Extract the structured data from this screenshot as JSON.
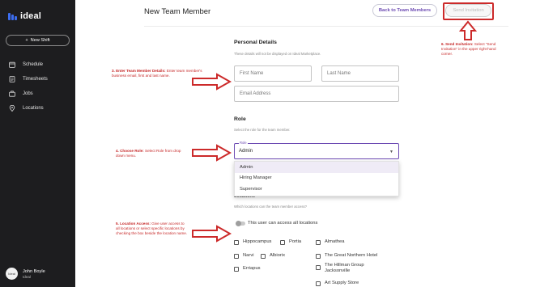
{
  "app": {
    "logo_text": "ideal"
  },
  "sidebar": {
    "new_shift_label": "New Shift",
    "items": [
      {
        "label": "Schedule",
        "icon": "calendar-icon"
      },
      {
        "label": "Timesheets",
        "icon": "timesheet-icon"
      },
      {
        "label": "Jobs",
        "icon": "briefcase-icon"
      },
      {
        "label": "Locations",
        "icon": "location-pin-icon"
      }
    ],
    "user": {
      "avatar_text": "Ideal",
      "name": "John Boyle",
      "org": "Ideal"
    }
  },
  "header": {
    "title": "New Team Member",
    "back_label": "Back to Team Members",
    "send_label": "Send Invitation"
  },
  "personal": {
    "title": "Personal Details",
    "subtitle": "These details will not be displayed on Ideal Marketplace.",
    "first_name_placeholder": "First Name",
    "last_name_placeholder": "Last Name",
    "email_placeholder": "Email Address"
  },
  "role": {
    "title": "Role",
    "subtitle": "Select the role for the team member.",
    "field_label": "Role",
    "value": "Admin",
    "options": [
      "Admin",
      "Hiring Manager",
      "Supervisor"
    ]
  },
  "locations": {
    "title": "Locations",
    "subtitle": "Which locations can the team member access?",
    "toggle_label": "This user can access all locations",
    "items": [
      "Hippocampus",
      "Portia",
      "Almathea",
      "Narvi",
      "Albiorix",
      "The Great Northern Hotel",
      "Erriapus",
      "The Hillman Group Jacksonville",
      "Art Supply Store"
    ]
  },
  "annotations": {
    "a3_title": "3.  Enter Team Member Details:",
    "a3_body": "Enter team member's business email, first and last name.",
    "a4_title": "4.  Choose Role:",
    "a4_body": "Select Role from drop down menu.",
    "a5_title": "5.  Location Access:",
    "a5_body": "Give user access to all locations or select specific locations by checking the box beside the location name.",
    "a6_title": "6.  Send Invitation:",
    "a6_body": "Select \"Send Invitation\" in the upper right-hand corner."
  },
  "colors": {
    "sidebar_bg": "#1d1d1f",
    "accent": "#6d4bb3",
    "annotation": "#c62828",
    "logo": "#3c6df0"
  }
}
